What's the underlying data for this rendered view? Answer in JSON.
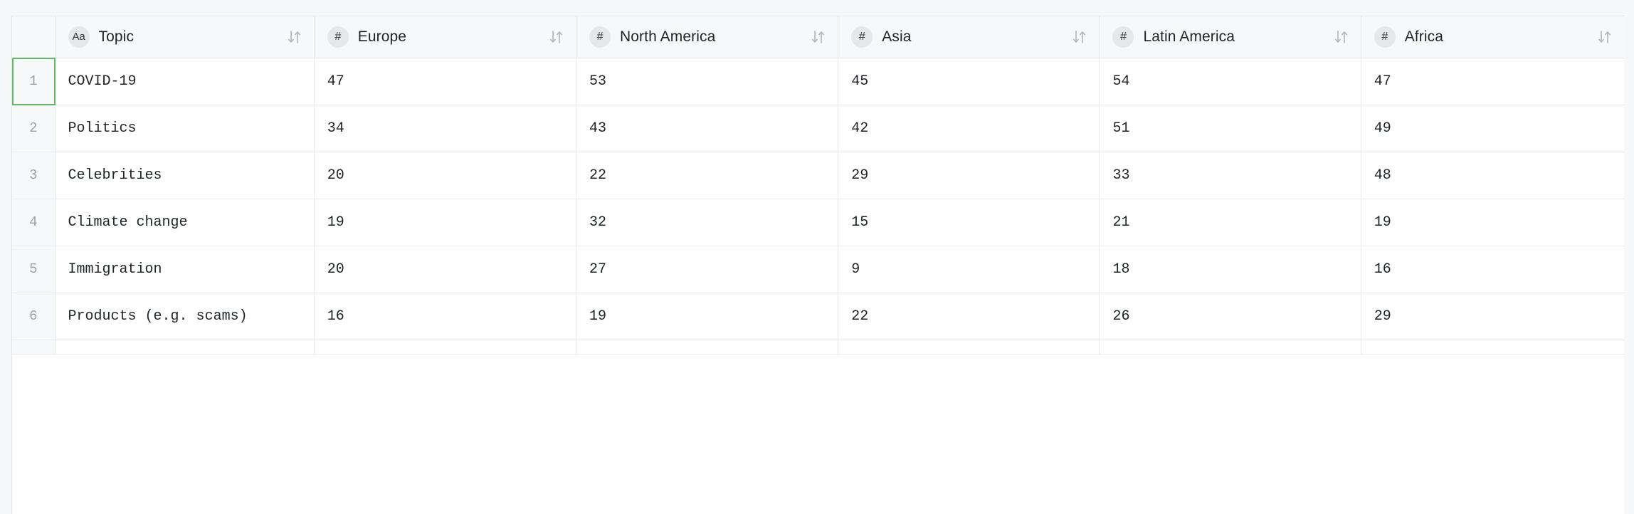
{
  "table": {
    "row_number_header": "",
    "selected_row_index": 1,
    "columns": [
      {
        "label": "Topic",
        "type_badge": "Aa",
        "type": "text",
        "sort_icon": "sort-updown-icon"
      },
      {
        "label": "Europe",
        "type_badge": "#",
        "type": "number",
        "sort_icon": "sort-updown-icon"
      },
      {
        "label": "North America",
        "type_badge": "#",
        "type": "number",
        "sort_icon": "sort-updown-icon"
      },
      {
        "label": "Asia",
        "type_badge": "#",
        "type": "number",
        "sort_icon": "sort-updown-icon"
      },
      {
        "label": "Latin America",
        "type_badge": "#",
        "type": "number",
        "sort_icon": "sort-updown-icon"
      },
      {
        "label": "Africa",
        "type_badge": "#",
        "type": "number",
        "sort_icon": "sort-updown-icon"
      }
    ],
    "rows": [
      {
        "n": "1",
        "topic": "COVID-19",
        "europe": "47",
        "north_america": "53",
        "asia": "45",
        "latin_america": "54",
        "africa": "47"
      },
      {
        "n": "2",
        "topic": "Politics",
        "europe": "34",
        "north_america": "43",
        "asia": "42",
        "latin_america": "51",
        "africa": "49"
      },
      {
        "n": "3",
        "topic": "Celebrities",
        "europe": "20",
        "north_america": "22",
        "asia": "29",
        "latin_america": "33",
        "africa": "48"
      },
      {
        "n": "4",
        "topic": "Climate change",
        "europe": "19",
        "north_america": "32",
        "asia": "15",
        "latin_america": "21",
        "africa": "19"
      },
      {
        "n": "5",
        "topic": "Immigration",
        "europe": "20",
        "north_america": "27",
        "asia": "9",
        "latin_america": "18",
        "africa": "16"
      },
      {
        "n": "6",
        "topic": "Products (e.g. scams)",
        "europe": "16",
        "north_america": "19",
        "asia": "22",
        "latin_america": "26",
        "africa": "29"
      }
    ]
  },
  "colors": {
    "selection_green": "#63b863",
    "header_bg": "#f7f8f9",
    "cell_bg": "#ffffff",
    "border": "#e8eaec",
    "page_bg": "#f6f7f9",
    "badge_bg": "#e6e7e8",
    "row_number_text": "#9aa0a6"
  }
}
